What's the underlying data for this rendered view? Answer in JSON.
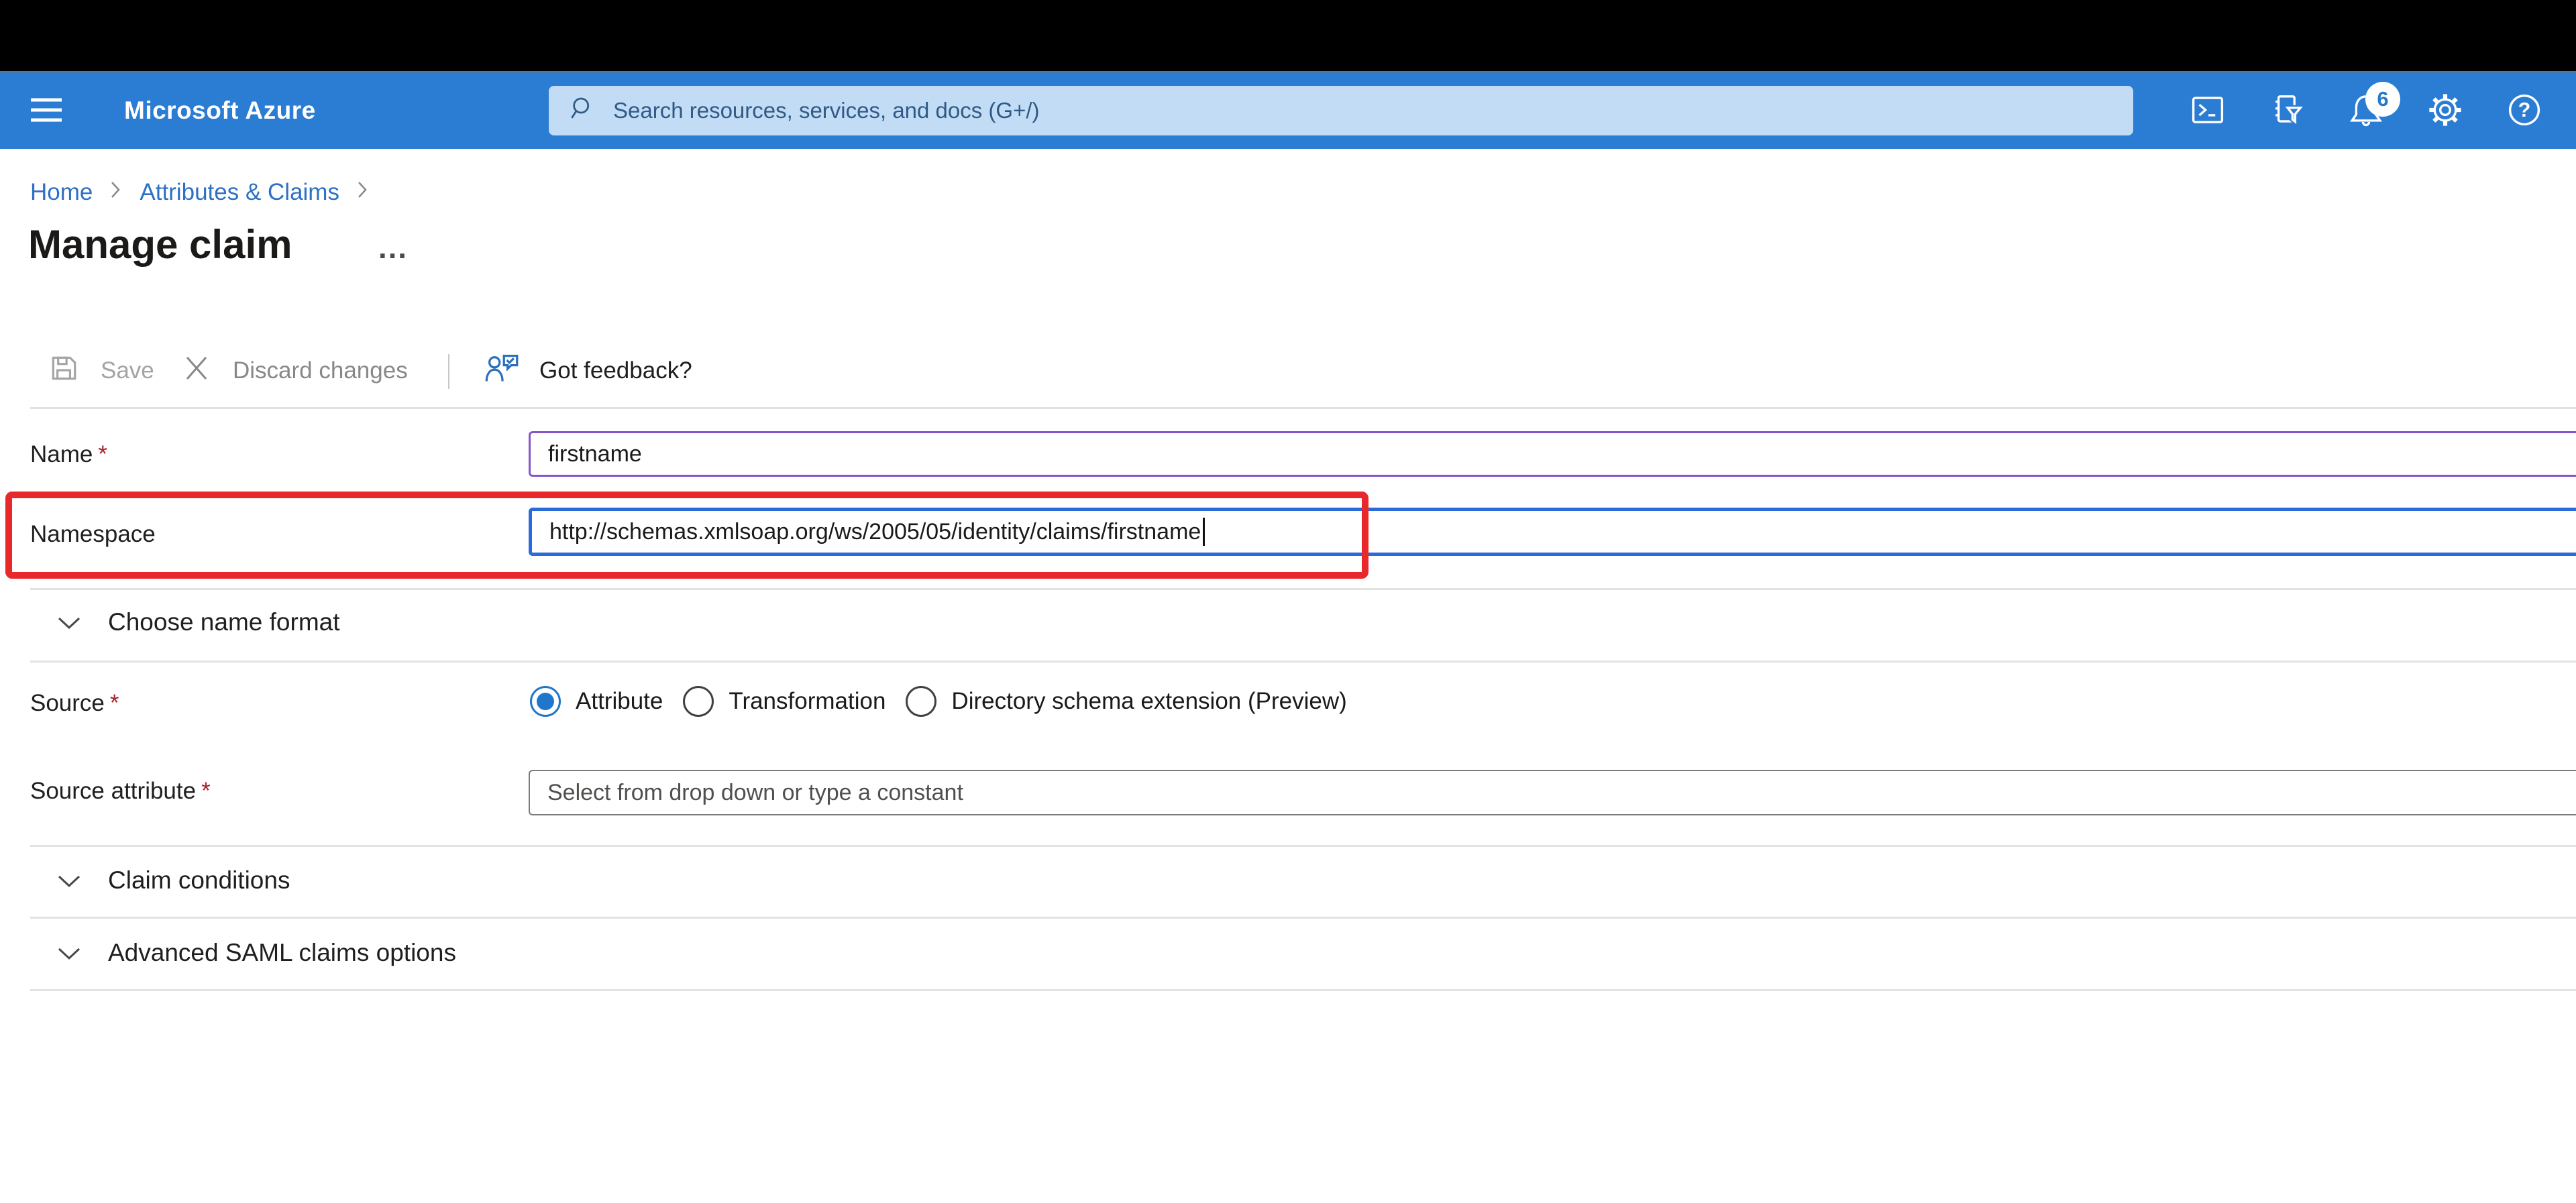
{
  "topbar": {
    "brand": "Microsoft Azure",
    "search_placeholder": "Search resources, services, and docs (G+/)",
    "notification_count": "6",
    "icons": [
      "cloud-shell",
      "directories-filter",
      "notifications",
      "settings",
      "help"
    ]
  },
  "breadcrumb": {
    "items": [
      "Home",
      "Attributes & Claims"
    ]
  },
  "page": {
    "title": "Manage claim",
    "more_label": "…"
  },
  "toolbar": {
    "save_label": "Save",
    "discard_label": "Discard changes",
    "feedback_label": "Got feedback?"
  },
  "form": {
    "required_marker": "*",
    "name": {
      "label": "Name",
      "value": "firstname"
    },
    "namespace": {
      "label": "Namespace",
      "value": "http://schemas.xmlsoap.org/ws/2005/05/identity/claims/firstname"
    },
    "sections": {
      "choose_name_format": "Choose name format",
      "claim_conditions": "Claim conditions",
      "advanced_saml": "Advanced SAML claims options"
    },
    "source": {
      "label": "Source",
      "options": [
        "Attribute",
        "Transformation",
        "Directory schema extension (Preview)"
      ],
      "selected": "Attribute"
    },
    "source_attribute": {
      "label": "Source attribute",
      "placeholder": "Select from drop down or type a constant"
    }
  },
  "colors": {
    "topbar_blue": "#2B7CD3",
    "search_bg": "#C3DCF5",
    "link_blue": "#2E70C4",
    "focus_border_blue": "#2A6BD9",
    "name_border_purple": "#8456C8",
    "annotation_red": "#E9282B",
    "required_red": "#A4262C",
    "radio_selected_blue": "#1F76CC"
  }
}
